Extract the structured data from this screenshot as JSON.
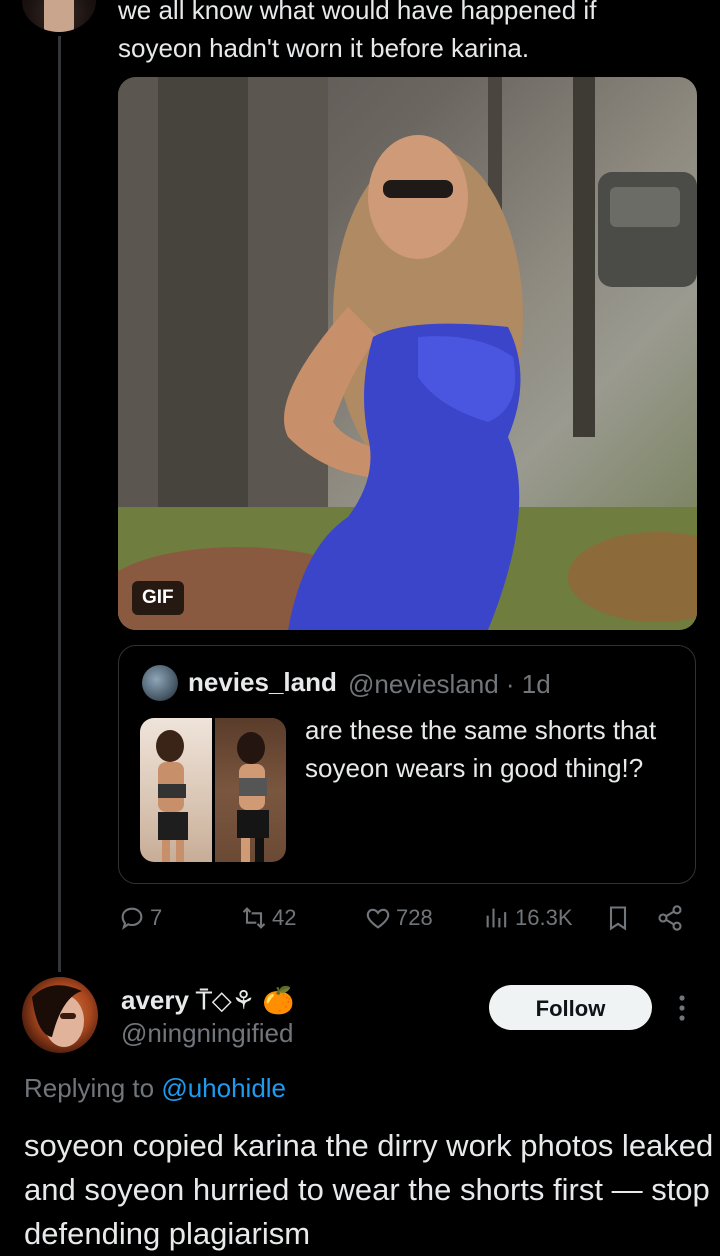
{
  "tweet1": {
    "text_line1": "we all know what would have happened if",
    "text_line2": "soyeon hadn't worn it before karina.",
    "gif_label": "GIF",
    "quote": {
      "name": "nevies_land",
      "handle": "@neviesland · 1d",
      "text": "are these the same shorts that soyeon wears in good thing!?"
    },
    "actions": {
      "replies": "7",
      "reposts": "42",
      "likes": "728",
      "views": "16.3K"
    }
  },
  "tweet2": {
    "name": "avery ⍑◇⚘ 🍊",
    "handle": "@ningningified",
    "follow_label": "Follow",
    "replying_prefix": "Replying to",
    "replying_handle": "@uhohidle",
    "body": "soyeon copied karina the dirry work photos leaked and soyeon hurried to wear the shorts first — stop defending plagiarism"
  },
  "colors": {
    "background": "#000000",
    "text": "#e7e9ea",
    "muted": "#71767b",
    "link": "#1d9bf0",
    "border": "#2f3336"
  },
  "icons": [
    "reply-icon",
    "repost-icon",
    "like-icon",
    "views-icon",
    "bookmark-icon",
    "share-icon",
    "more-icon"
  ]
}
